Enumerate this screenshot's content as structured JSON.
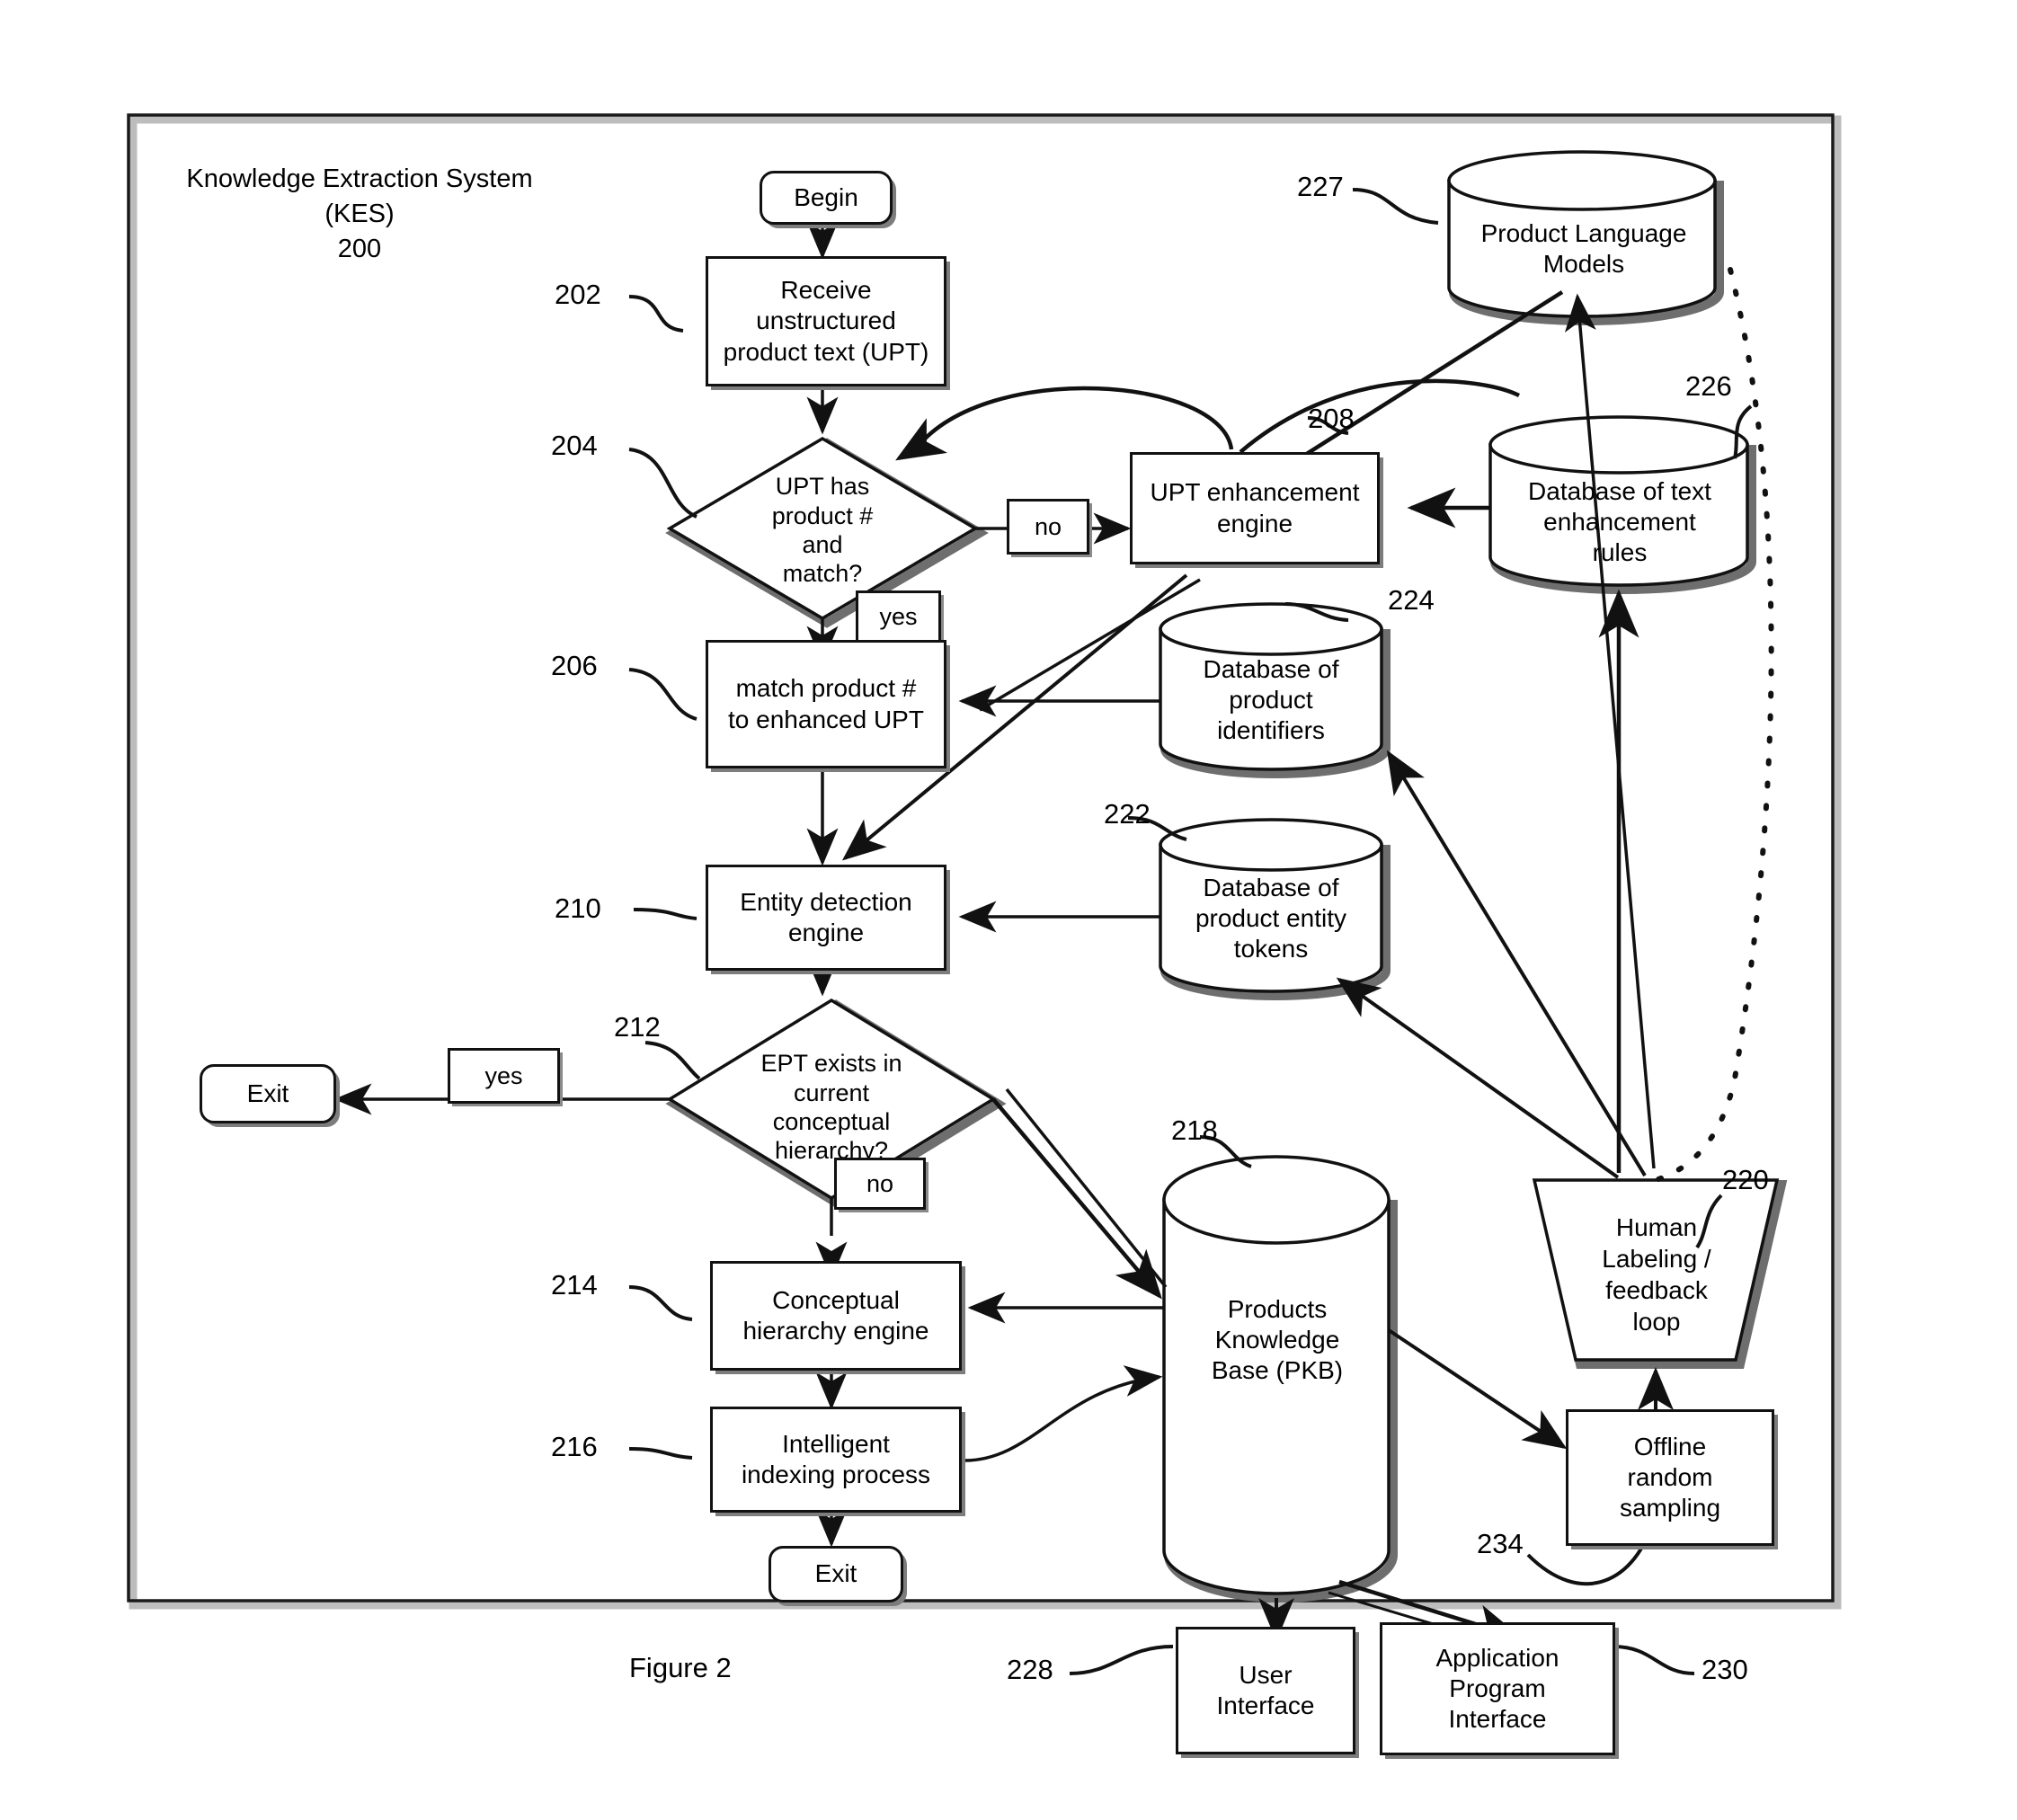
{
  "figure": {
    "caption": "Figure 2",
    "system_title": "Knowledge Extraction System\n(KES)\n200"
  },
  "diagram": {
    "type": "flowchart",
    "terminals": [
      {
        "id": "begin",
        "label": "Begin"
      },
      {
        "id": "exit_left",
        "label": "Exit"
      },
      {
        "id": "exit_bottom",
        "label": "Exit"
      }
    ],
    "process_steps": [
      {
        "ref": "202",
        "label": "Receive\nunstructured\nproduct text (UPT)"
      },
      {
        "ref": "208",
        "label": "UPT enhancement\nengine"
      },
      {
        "ref": "206",
        "label": "match product #\nto enhanced UPT"
      },
      {
        "ref": "210",
        "label": "Entity detection\nengine"
      },
      {
        "ref": "214",
        "label": "Conceptual\nhierarchy engine"
      },
      {
        "ref": "216",
        "label": "Intelligent\nindexing process"
      },
      {
        "ref": "234",
        "label": "Offline\nrandom\nsampling"
      },
      {
        "ref": "228",
        "label": "User\nInterface"
      },
      {
        "ref": "230",
        "label": "Application\nProgram\nInterface"
      }
    ],
    "decisions": [
      {
        "ref": "204",
        "label": "UPT has\nproduct #\nand\nmatch?",
        "branches": [
          "no",
          "yes"
        ]
      },
      {
        "ref": "212",
        "label": "EPT exists in\ncurrent\nconceptual\nhierarchy?",
        "branches": [
          "yes",
          "no"
        ]
      }
    ],
    "datastores": [
      {
        "ref": "227",
        "label": "Product Language\nModels"
      },
      {
        "ref": "226",
        "label": "Database of  text\nenhancement\nrules"
      },
      {
        "ref": "224",
        "label": "Database of\nproduct\nidentifiers"
      },
      {
        "ref": "222",
        "label": "Database of\nproduct entity\ntokens"
      },
      {
        "ref": "218",
        "label": "Products\nKnowledge\nBase (PKB)"
      }
    ],
    "manual_ops": [
      {
        "ref": "220",
        "label": "Human\nLabeling /\nfeedback\nloop"
      }
    ],
    "branch_labels": {
      "no_upper": "no",
      "yes_upper": "yes",
      "yes_lower": "yes",
      "no_lower": "no"
    },
    "reference_numerals": [
      "200",
      "202",
      "204",
      "206",
      "208",
      "210",
      "212",
      "214",
      "216",
      "218",
      "220",
      "222",
      "224",
      "226",
      "227",
      "228",
      "230",
      "234"
    ]
  },
  "colors": {
    "ink": "#111111",
    "shadow": "#7d7d7d",
    "frame": "#1a1a1a",
    "paper": "#ffffff"
  }
}
